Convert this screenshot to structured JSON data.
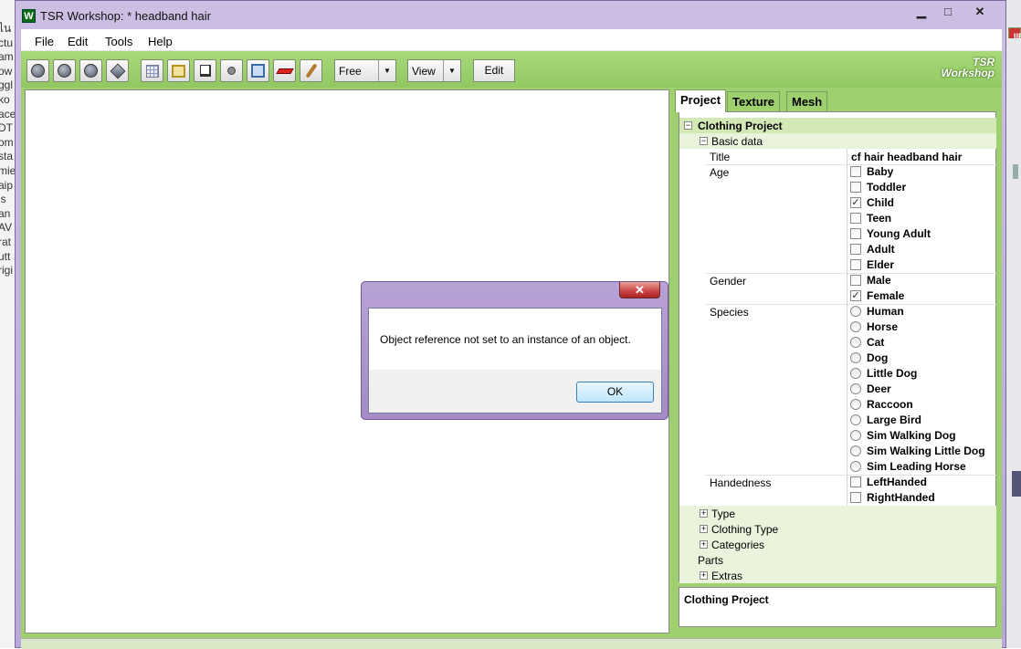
{
  "background_window": {
    "left_text": [
      "ไน",
      "ctu",
      "am",
      "ow",
      "ggl",
      "ko",
      "ace",
      "DT",
      "om",
      "sta",
      "mie",
      "aip",
      "is",
      "an",
      "AV",
      "rat",
      "utt",
      "rigi"
    ],
    "right_tab": "IIE"
  },
  "window": {
    "title": "TSR Workshop: * headband hair",
    "app_icon": "W",
    "controls": {
      "minimize": "▁",
      "maximize": "□",
      "close": "✕"
    }
  },
  "menu": {
    "items": [
      "File",
      "Edit",
      "Tools",
      "Help"
    ]
  },
  "toolbar": {
    "icons": [
      "sphere-icon",
      "sphere-icon",
      "sphere-icon",
      "diamond-icon",
      "grid-icon",
      "cube-icon",
      "plane-icon",
      "dot-icon",
      "frame-icon",
      "red-shape-icon",
      "bone-icon"
    ],
    "camera_mode": "Free",
    "view_label": "View",
    "edit_label": "Edit",
    "logo_line1": "TSR",
    "logo_line2": "Workshop"
  },
  "tabs": [
    "Project",
    "Texture",
    "Mesh"
  ],
  "properties": {
    "root": "Clothing Project",
    "basic_data": "Basic data",
    "title_label": "Title",
    "title_value": "cf hair headband hair",
    "age_label": "Age",
    "age_options": [
      {
        "label": "Baby",
        "checked": false
      },
      {
        "label": "Toddler",
        "checked": false
      },
      {
        "label": "Child",
        "checked": true
      },
      {
        "label": "Teen",
        "checked": false
      },
      {
        "label": "Young Adult",
        "checked": false
      },
      {
        "label": "Adult",
        "checked": false
      },
      {
        "label": "Elder",
        "checked": false
      }
    ],
    "gender_label": "Gender",
    "gender_options": [
      {
        "label": "Male",
        "checked": false
      },
      {
        "label": "Female",
        "checked": true
      }
    ],
    "species_label": "Species",
    "species_options": [
      "Human",
      "Horse",
      "Cat",
      "Dog",
      "Little Dog",
      "Deer",
      "Raccoon",
      "Large Bird",
      "Sim Walking Dog",
      "Sim Walking Little Dog",
      "Sim Leading Horse"
    ],
    "handedness_label": "Handedness",
    "handedness_options": [
      {
        "label": "LeftHanded",
        "checked": false
      },
      {
        "label": "RightHanded",
        "checked": false
      }
    ],
    "collapsed": [
      "Type",
      "Clothing Type",
      "Categories"
    ],
    "parts": "Parts",
    "extras": "Extras"
  },
  "description": "Clothing Project",
  "dialog": {
    "close": "✕",
    "message": "Object reference not set to an instance of an object.",
    "ok": "OK"
  }
}
